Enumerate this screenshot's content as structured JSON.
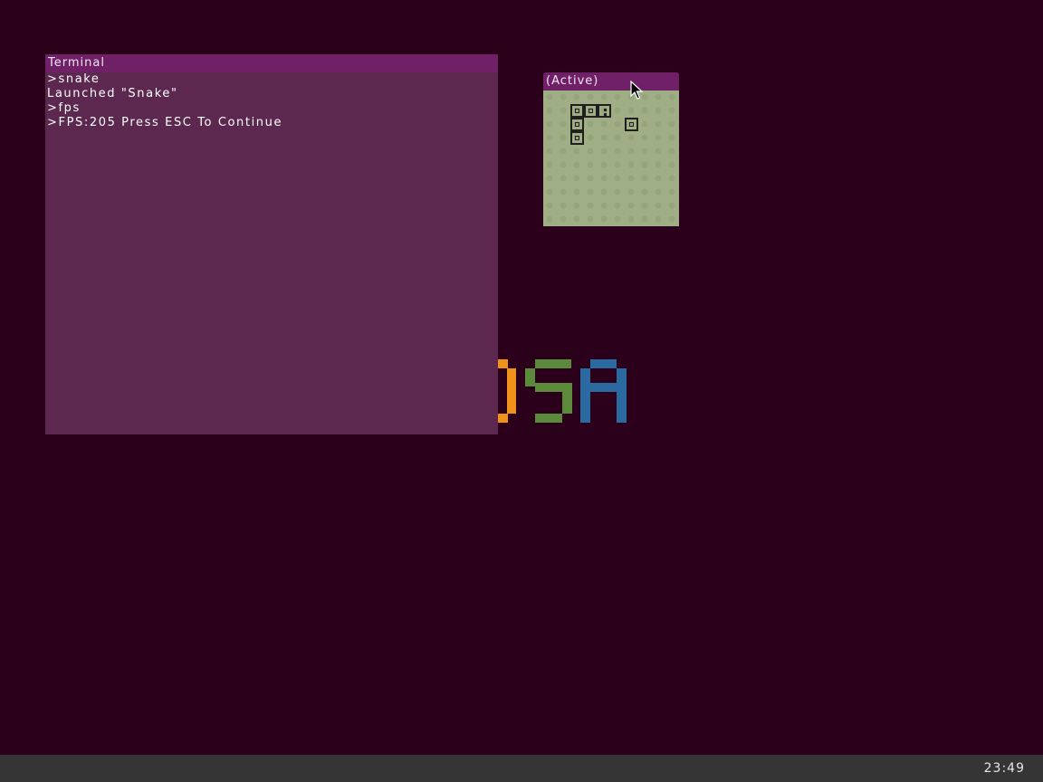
{
  "terminal": {
    "title": "Terminal",
    "lines": [
      ">snake",
      "Launched \"Snake\"",
      ">fps",
      ">FPS:205 Press ESC To Continue"
    ]
  },
  "snake_window": {
    "title": "(Active)"
  },
  "logo": {
    "colors": {
      "o": "#f0921a",
      "s": "#5b8b3a",
      "a": "#2b6aa0"
    }
  },
  "taskbar": {
    "clock": "23:49"
  },
  "colors": {
    "desktop": "#2a001b",
    "window_title": "#6f2067",
    "terminal_bg": "#5c284f",
    "game_bg": "#9fae84",
    "taskbar": "#353535"
  },
  "icons": {
    "cursor": "arrow-cursor-icon"
  }
}
